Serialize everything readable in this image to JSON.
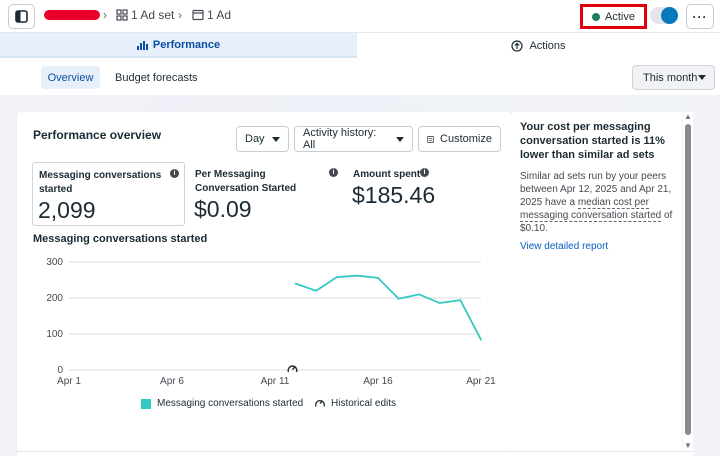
{
  "header": {
    "breadcrumb": [
      {
        "label": "1 Ad set"
      },
      {
        "label": "1 Ad"
      }
    ],
    "status": "Active",
    "more_label": "···"
  },
  "tabs": [
    {
      "label": "Performance",
      "selected": true
    },
    {
      "label": "Actions",
      "selected": false
    }
  ],
  "subtabs": [
    {
      "label": "Overview",
      "selected": true
    },
    {
      "label": "Budget forecasts",
      "selected": false
    }
  ],
  "date_range": "This month",
  "overview": {
    "title": "Performance overview",
    "day_label": "Day",
    "activity_label": "Activity history: All",
    "customize_label": "Customize",
    "metrics": [
      {
        "label": "Messaging conversations started",
        "value": "2,099"
      },
      {
        "label": "Per Messaging Conversation Started",
        "value": "$0.09"
      },
      {
        "label": "Amount spent",
        "value": "$185.46"
      }
    ],
    "chart_title": "Messaging conversations started",
    "legend": {
      "series": "Messaging conversations started",
      "edits": "Historical edits"
    }
  },
  "chart_data": {
    "type": "line",
    "title": "Messaging conversations started",
    "x": [
      "Apr 12",
      "Apr 13",
      "Apr 14",
      "Apr 15",
      "Apr 16",
      "Apr 17",
      "Apr 18",
      "Apr 19",
      "Apr 20",
      "Apr 21"
    ],
    "xticks": [
      "Apr 1",
      "Apr 6",
      "Apr 11",
      "Apr 16",
      "Apr 21"
    ],
    "yticks": [
      "0",
      "100",
      "200",
      "300"
    ],
    "series": [
      {
        "name": "Messaging conversations started",
        "color": "#33c9c3",
        "values": [
          240,
          220,
          258,
          262,
          256,
          198,
          210,
          186,
          194,
          84
        ]
      }
    ],
    "xrange": [
      "Apr 1",
      "Apr 21"
    ],
    "ylim": [
      0,
      300
    ],
    "grid": true,
    "legend_position": "bottom",
    "historical_edit_marker": "Apr 12"
  },
  "insight": {
    "heading": "Your cost per messaging conversation started is 11% lower than similar ad sets",
    "body_1": "Similar ad sets run by your peers between Apr 12, 2025 and Apr 21, 2025 have a ",
    "body_underline": "median cost per messaging conversation started",
    "body_2": " of $0.10.",
    "link": "View detailed report"
  }
}
